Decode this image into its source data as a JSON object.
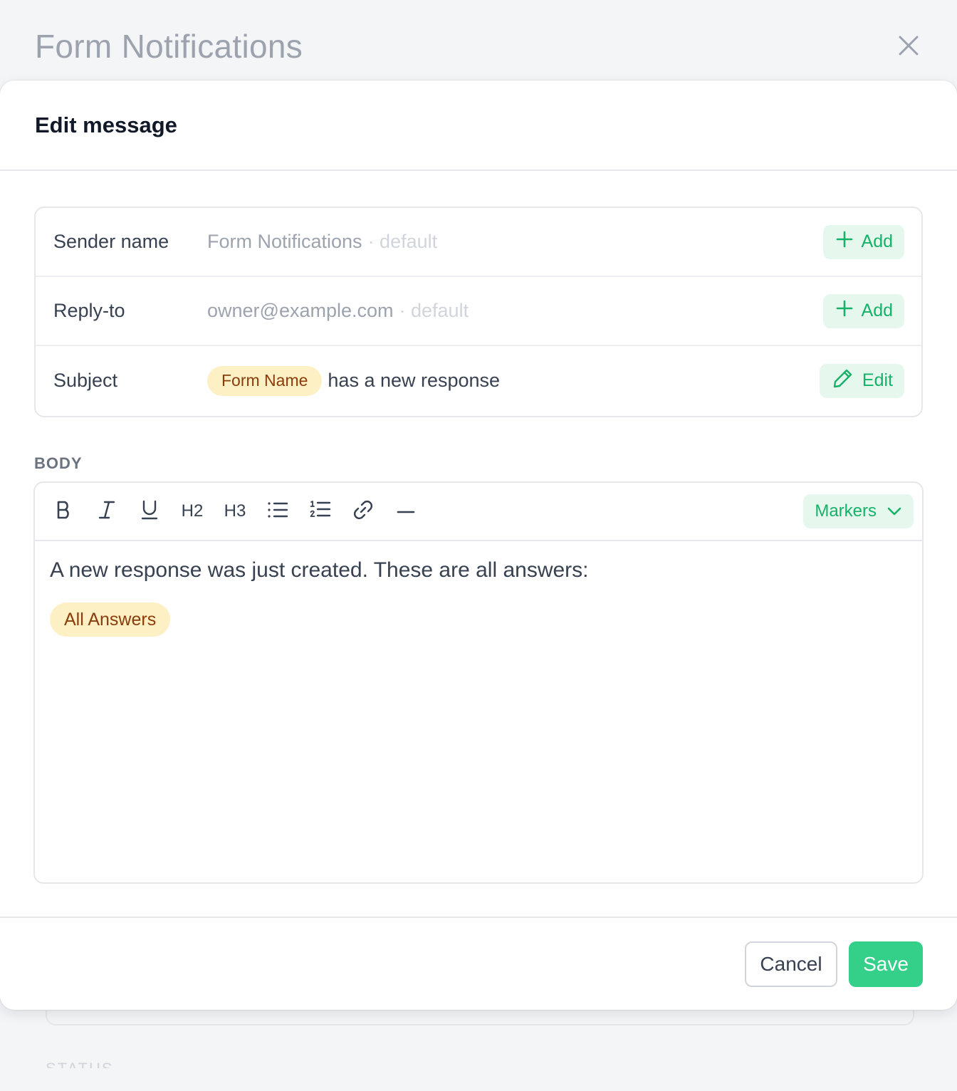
{
  "background": {
    "title": "Form Notifications",
    "status_label": "STATUS"
  },
  "modal": {
    "title": "Edit message",
    "fields": [
      {
        "label": "Sender name",
        "value": "Form Notifications",
        "suffix": "· default",
        "button": "Add",
        "button_icon": "plus-icon"
      },
      {
        "label": "Reply-to",
        "value": "owner@example.com",
        "suffix": "· default",
        "button": "Add",
        "button_icon": "plus-icon"
      },
      {
        "label": "Subject",
        "marker": "Form Name",
        "value": "has a new response",
        "button": "Edit",
        "button_icon": "pencil-icon"
      }
    ],
    "body_label": "BODY",
    "toolbar": {
      "heading2": "H2",
      "heading3": "H3",
      "markers_label": "Markers"
    },
    "body_text": "A new response was just created. These are all answers:",
    "body_marker": "All Answers",
    "cancel_label": "Cancel",
    "save_label": "Save"
  },
  "colors": {
    "accent": "#16b26a",
    "accent_bg": "#e6f7ee",
    "save_bg": "#34d08a",
    "marker_bg": "#fdf0c4",
    "marker_text": "#8a3c0a"
  }
}
